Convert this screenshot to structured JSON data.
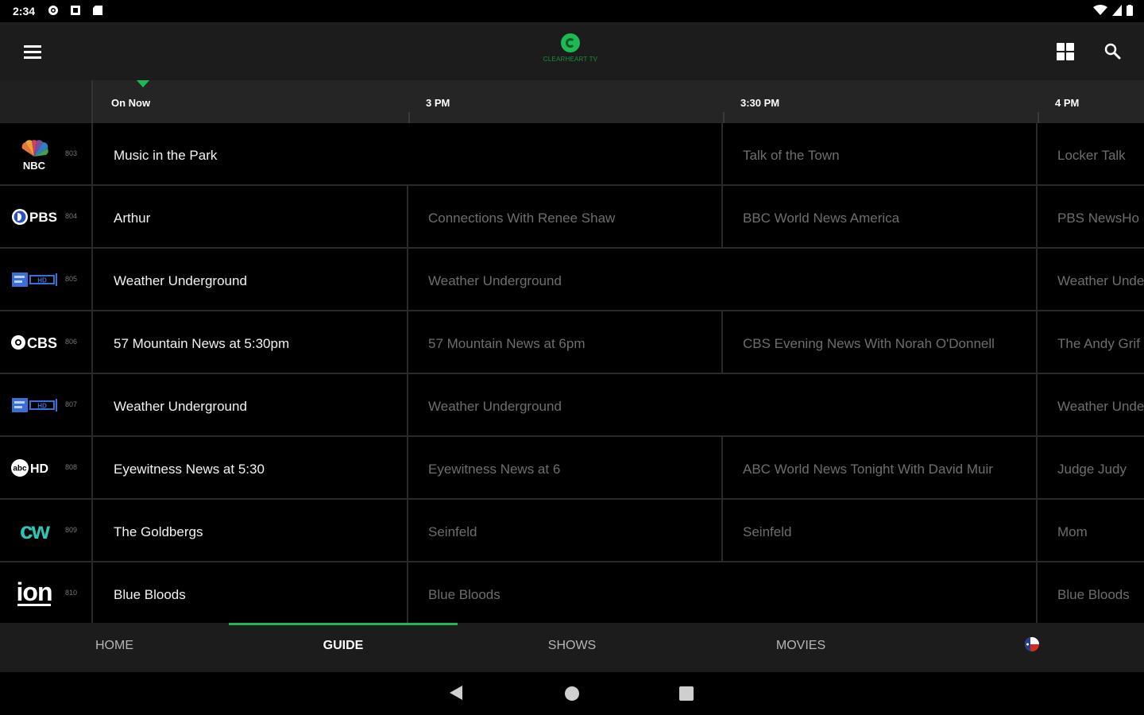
{
  "status_bar": {
    "time": "2:34",
    "icons": [
      "settings-icon",
      "sim-icon",
      "sd-card-icon",
      "wifi-icon",
      "signal-icon",
      "battery-icon"
    ]
  },
  "app_bar": {
    "logo_text": "CLEARHEART TV",
    "icons": [
      "menu-icon",
      "grid-view-icon",
      "search-icon"
    ]
  },
  "time_header": {
    "slots": [
      "On Now",
      "3 PM",
      "3:30 PM",
      "4 PM"
    ]
  },
  "guide": {
    "channels": [
      {
        "logo": "NBC",
        "number": "803",
        "programs": [
          "Music in the Park",
          "Talk of the Town",
          "Locker Talk"
        ]
      },
      {
        "logo": "PBS",
        "number": "804",
        "programs": [
          "Arthur",
          "Connections With Renee Shaw",
          "BBC World News America",
          "PBS NewsHo"
        ]
      },
      {
        "logo": "Weather HD",
        "number": "805",
        "programs": [
          "Weather Underground",
          "Weather Underground",
          "Weather Unde"
        ]
      },
      {
        "logo": "CBS",
        "number": "806",
        "programs": [
          "57 Mountain News at 5:30pm",
          "57 Mountain News at 6pm",
          "CBS Evening News With Norah O'Donnell",
          "The Andy Grif"
        ]
      },
      {
        "logo": "Weather HD",
        "number": "807",
        "programs": [
          "Weather Underground",
          "Weather Underground",
          "Weather Unde"
        ]
      },
      {
        "logo": "abc HD",
        "number": "808",
        "programs": [
          "Eyewitness News at 5:30",
          "Eyewitness News at 6",
          "ABC World News Tonight With David Muir",
          "Judge Judy"
        ]
      },
      {
        "logo": "CW",
        "number": "809",
        "programs": [
          "The Goldbergs",
          "Seinfeld",
          "Seinfeld",
          "Mom"
        ]
      },
      {
        "logo": "ion",
        "number": "810",
        "programs": [
          "Blue Bloods",
          "Blue Bloods",
          "Blue Bloods"
        ]
      }
    ]
  },
  "tabs": {
    "home": "HOME",
    "guide": "GUIDE",
    "shows": "SHOWS",
    "movies": "MOVIES",
    "active": "GUIDE"
  },
  "colors": {
    "accent": "#1db954",
    "appbar": "#1c1c1c",
    "header": "#252525",
    "background": "#000000"
  }
}
